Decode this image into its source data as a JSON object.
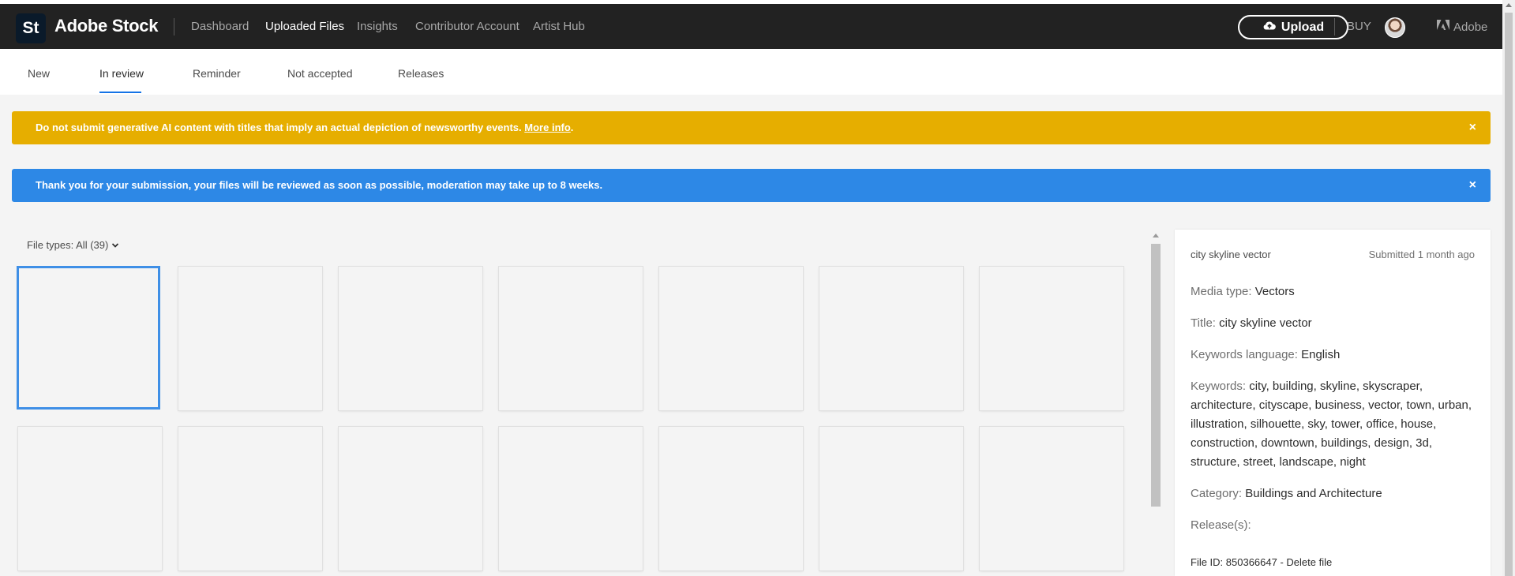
{
  "header": {
    "logo_text": "St",
    "brand": "Adobe Stock",
    "nav": [
      {
        "label": "Dashboard"
      },
      {
        "label": "Uploaded Files",
        "active": true
      },
      {
        "label": "Insights"
      },
      {
        "label": "Contributor Account"
      },
      {
        "label": "Artist Hub"
      }
    ],
    "upload_label": "Upload",
    "buy_label": "BUY",
    "adobe_label": "Adobe"
  },
  "subnav": {
    "tabs": [
      {
        "label": "New"
      },
      {
        "label": "In review",
        "active": true
      },
      {
        "label": "Reminder"
      },
      {
        "label": "Not accepted"
      },
      {
        "label": "Releases"
      }
    ]
  },
  "banners": {
    "ai_notice": "Do not submit generative AI content with titles that imply an actual depiction of newsworthy events.",
    "ai_link": "More info",
    "ai_link_suffix": ".",
    "review_notice": "Thank you for your submission, your files will be reviewed as soon as possible, moderation may take up to 8 weeks.",
    "close_glyph": "×"
  },
  "filter": {
    "label": "File types: All (39)"
  },
  "panel": {
    "title": "city skyline vector",
    "submitted": "Submitted 1 month ago",
    "media_type_label": "Media type:",
    "media_type_value": "Vectors",
    "title_label": "Title:",
    "title_value": "city skyline vector",
    "keywords_language_label": "Keywords language:",
    "keywords_language_value": "English",
    "keywords_label": "Keywords:",
    "keywords_value": "city, building, skyline, skyscraper, architecture, cityscape, business, vector, town, urban, illustration, silhouette, sky, tower, office, house, construction, downtown, buildings, design, 3d, structure, street, landscape, night",
    "category_label": "Category:",
    "category_value": "Buildings and Architecture",
    "releases_label": "Release(s):",
    "file_id": "File ID: 850366647 - Delete file"
  },
  "colors": {
    "header_bg": "#222222",
    "ai_banner": "#e6ae00",
    "info_banner": "#2d88e6",
    "accent": "#1473e6"
  }
}
